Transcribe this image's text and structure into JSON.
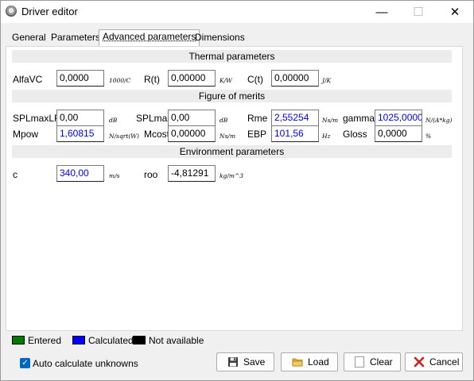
{
  "window": {
    "title": "Driver editor",
    "minimize_glyph": "—",
    "maximize_glyph": "☐",
    "close_glyph": "✕"
  },
  "tabs": [
    {
      "label": "General"
    },
    {
      "label": "Parameters"
    },
    {
      "label": "Advanced parameters",
      "active": true
    },
    {
      "label": "Dimensions"
    }
  ],
  "thermal": {
    "header": "Thermal parameters",
    "alfavc": {
      "label": "AlfaVC",
      "value": "0,0000",
      "unit": "1000/C"
    },
    "rt": {
      "label": "R(t)",
      "value": "0,00000",
      "unit": "K/W"
    },
    "ct": {
      "label": "C(t)",
      "value": "0,00000",
      "unit": "J/K"
    }
  },
  "merits": {
    "header": "Figure of merits",
    "splmaxlf": {
      "label": "SPLmaxLF",
      "value": "0,00",
      "unit": "dB"
    },
    "splmax": {
      "label": "SPLmax",
      "value": "0,00",
      "unit": "dB"
    },
    "rme": {
      "label": "Rme",
      "value": "2,55254",
      "unit": "Ns/m"
    },
    "gamma": {
      "label": "gamma",
      "value": "1025,00000",
      "unit": "N/(A*kg)"
    },
    "mpow": {
      "label": "Mpow",
      "value": "1,60815",
      "unit": "N/sqrt(W)"
    },
    "mcost": {
      "label": "Mcost",
      "value": "0,00000",
      "unit": "Ns/m"
    },
    "ebp": {
      "label": "EBP",
      "value": "101,56",
      "unit": "Hz"
    },
    "gloss": {
      "label": "Gloss",
      "value": "0,0000",
      "unit": "%"
    }
  },
  "environment": {
    "header": "Environment parameters",
    "c": {
      "label": "c",
      "value": "340,00",
      "unit": "m/s"
    },
    "roo": {
      "label": "roo",
      "value": "-4,81291",
      "unit": "kg/m^3"
    }
  },
  "legend": [
    {
      "label": "Entered",
      "color": "#007d00"
    },
    {
      "label": "Calculated",
      "color": "#0000ff"
    },
    {
      "label": "Not available",
      "color": "#000000"
    }
  ],
  "options": {
    "auto_calc_label": "Auto calculate unknowns",
    "auto_calc_checked": true
  },
  "buttons": {
    "save": "Save",
    "load": "Load",
    "clear": "Clear",
    "cancel": "Cancel"
  },
  "colors": {
    "calculated_text": "#0000ff",
    "section_bg": "#ececec",
    "accent": "#0067c0"
  }
}
